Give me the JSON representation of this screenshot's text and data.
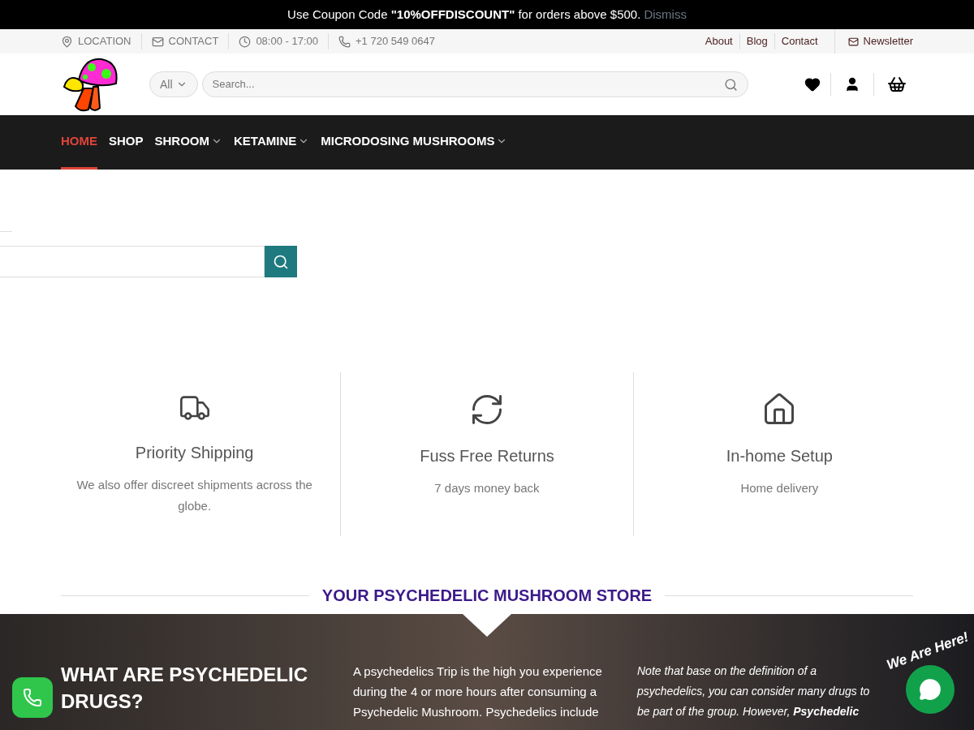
{
  "announcement": {
    "text": "Use Coupon Code **\"10%OFFDISCOUNT\"** for orders above $500.",
    "dismiss": "Dismiss"
  },
  "top_bar": {
    "info": [
      {
        "kind": "location",
        "label": "LOCATION"
      },
      {
        "kind": "contact",
        "label": "CONTACT"
      },
      {
        "kind": "hours",
        "label": "08:00 - 17:00"
      },
      {
        "kind": "phone",
        "label": "+1 720 549 0647"
      }
    ],
    "links": [
      "About",
      "Blog",
      "Contact"
    ],
    "newsletter": "Newsletter"
  },
  "header": {
    "category": "All",
    "search": {
      "placeholder": "Search..."
    }
  },
  "nav": [
    {
      "label": "HOME",
      "selected": true,
      "dropdown": false
    },
    {
      "label": "SHOP",
      "selected": false,
      "dropdown": false
    },
    {
      "label": "SHROOM",
      "selected": false,
      "dropdown": true
    },
    {
      "label": "KETAMINE",
      "selected": false,
      "dropdown": true
    },
    {
      "label": "MICRODOSING MUSHROOMS",
      "selected": false,
      "dropdown": true
    }
  ],
  "features": [
    {
      "kind": "truck",
      "title": "Priority Shipping",
      "text": "We also offer discreet shipments across the globe."
    },
    {
      "kind": "returns",
      "title": "Fuss Free Returns",
      "text": "7 days money back"
    },
    {
      "kind": "home",
      "title": "In-home Setup",
      "text": "Home delivery"
    }
  ],
  "section_title": "YOUR PSYCHEDELIC MUSHROOM STORE",
  "banner": {
    "heading": "WHAT ARE PSYCHEDELIC DRUGS?",
    "column_2": "A psychedelics Trip is the high you experience during the 4 or more hours after consuming a Psychedelic Mushroom. Psychedelics include",
    "column_3": "Note that base on the definition of a psychedelics, you can consider many drugs to be part of the group. However, **Psychedelic**"
  },
  "chat_widget": {
    "tagline": "We Are Here!"
  }
}
